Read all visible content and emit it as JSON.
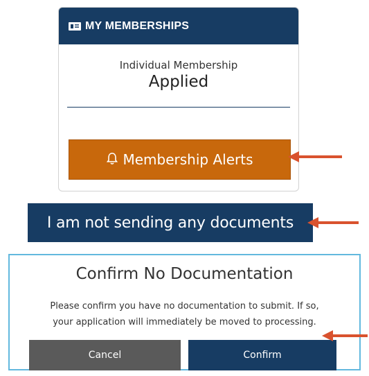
{
  "memberships_card": {
    "header_title": "MY MEMBERSHIPS",
    "header_icon": "id-card-icon",
    "membership_type": "Individual Membership",
    "membership_status": "Applied",
    "alerts_button": {
      "label": "Membership Alerts",
      "icon": "bell-icon",
      "bell_glyph": "🔔"
    }
  },
  "no_documents_button": {
    "label": "I am not sending any documents"
  },
  "confirm_dialog": {
    "title": "Confirm No Documentation",
    "message_line1": "Please confirm you have no documentation to submit. If so,",
    "message_line2": "your application will immediately be moved to processing.",
    "cancel_label": "Cancel",
    "confirm_label": "Confirm"
  },
  "colors": {
    "navy": "#173c63",
    "alert_orange": "#c8680c",
    "cancel_gray": "#5a5a5a",
    "dialog_border": "#62b8de",
    "annotation_arrow": "#d9522e"
  }
}
